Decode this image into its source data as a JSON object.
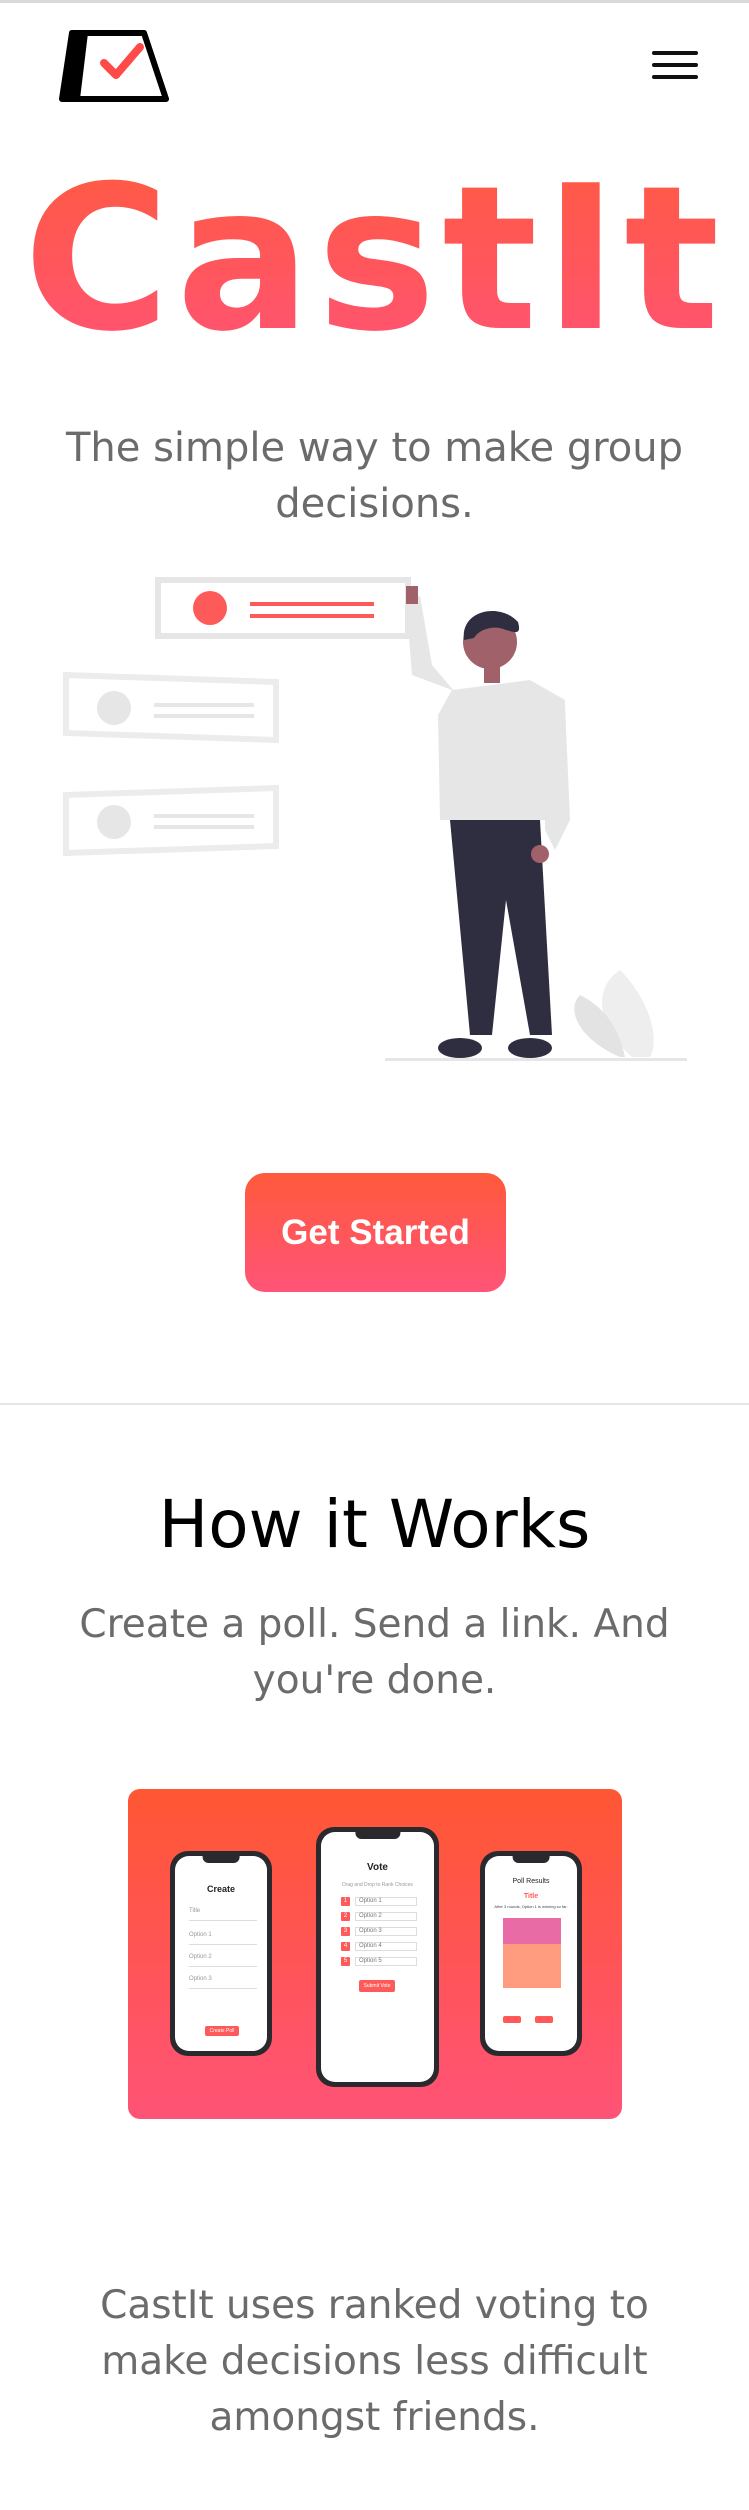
{
  "brand": {
    "logo_icon": "checkbox-logo-icon",
    "name": "CastIt",
    "tagline": "The simple way to make group decisions."
  },
  "nav": {
    "menu_icon": "hamburger-menu-icon"
  },
  "hero": {
    "illustration": "person-choosing-options-illustration",
    "cta_label": "Get Started"
  },
  "how_it_works": {
    "title": "How it Works",
    "subtitle": "Create a poll. Send a link. And you're done.",
    "screens": {
      "create": {
        "title": "Create",
        "fields": [
          "Title",
          "Option 1",
          "Option 2",
          "Option 3"
        ],
        "button": "Create Poll"
      },
      "vote": {
        "title": "Vote",
        "hint": "Drag and Drop to Rank Choices",
        "options": [
          "Option 1",
          "Option 2",
          "Option 3",
          "Option 4",
          "Option 5"
        ],
        "button": "Submit Vote"
      },
      "results": {
        "title": "Poll Results",
        "heading": "Title",
        "summary": "After 3 rounds, Option 1 is winning so far."
      }
    }
  },
  "footer": {
    "description": "CastIt uses ranked voting to make decisions less difficult amongst friends."
  },
  "colors": {
    "accent_top": "#ff5a40",
    "accent_bottom": "#ff5376",
    "text_muted": "#6b6b6b"
  }
}
